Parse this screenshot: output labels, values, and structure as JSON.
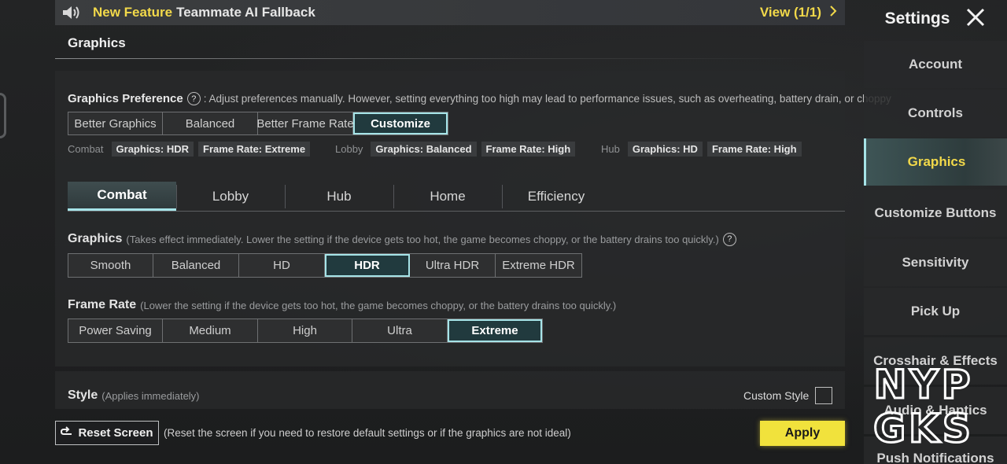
{
  "banner": {
    "label_highlight": "New Feature",
    "label_text": "Teammate AI Fallback",
    "view_label": "View (1/1)"
  },
  "section_title": "Graphics",
  "preference": {
    "label": "Graphics Preference",
    "description": ": Adjust preferences manually. However, setting everything too high may lead to performance issues, such as overheating, battery drain, or choppy",
    "options": [
      "Better Graphics",
      "Balanced",
      "Better Frame Rate",
      "Customize"
    ],
    "selected": "Customize"
  },
  "summary": {
    "combat": {
      "label": "Combat",
      "graphics": "Graphics: HDR",
      "frame_rate": "Frame Rate: Extreme"
    },
    "lobby": {
      "label": "Lobby",
      "graphics": "Graphics: Balanced",
      "frame_rate": "Frame Rate: High"
    },
    "hub": {
      "label": "Hub",
      "graphics": "Graphics: HD",
      "frame_rate": "Frame Rate: High"
    }
  },
  "tabs": [
    "Combat",
    "Lobby",
    "Hub",
    "Home",
    "Efficiency"
  ],
  "active_tab": "Combat",
  "graphics": {
    "label": "Graphics",
    "sub": "(Takes effect immediately. Lower the setting if the device gets too hot, the game becomes choppy, or the battery drains too quickly.)",
    "options": [
      "Smooth",
      "Balanced",
      "HD",
      "HDR",
      "Ultra HDR",
      "Extreme HDR"
    ],
    "selected": "HDR"
  },
  "frame_rate": {
    "label": "Frame Rate",
    "sub": "(Lower the setting if the device gets too hot, the game becomes choppy, or the battery drains too quickly.)",
    "options": [
      "Power Saving",
      "Medium",
      "High",
      "Ultra",
      "Extreme"
    ],
    "selected": "Extreme"
  },
  "style": {
    "label": "Style",
    "sub": "(Applies immediately)",
    "custom_label": "Custom Style"
  },
  "bottom": {
    "reset_label": "Reset Screen",
    "reset_note": "(Reset the screen if you need to restore default settings or if the graphics are not ideal)",
    "apply_label": "Apply"
  },
  "sidebar": {
    "title": "Settings",
    "items": [
      "Account",
      "Controls",
      "Graphics",
      "Customize Buttons",
      "Sensitivity",
      "Pick Up",
      "Crosshair & Effects",
      "Audio & Haptics",
      "Push Notifications"
    ],
    "active": "Graphics"
  },
  "watermark": {
    "line1": "NYP",
    "line2": "GKS"
  },
  "colors": {
    "accent": "#a6e4e8",
    "highlight": "#f2d94a",
    "apply": "#f1e23c"
  }
}
